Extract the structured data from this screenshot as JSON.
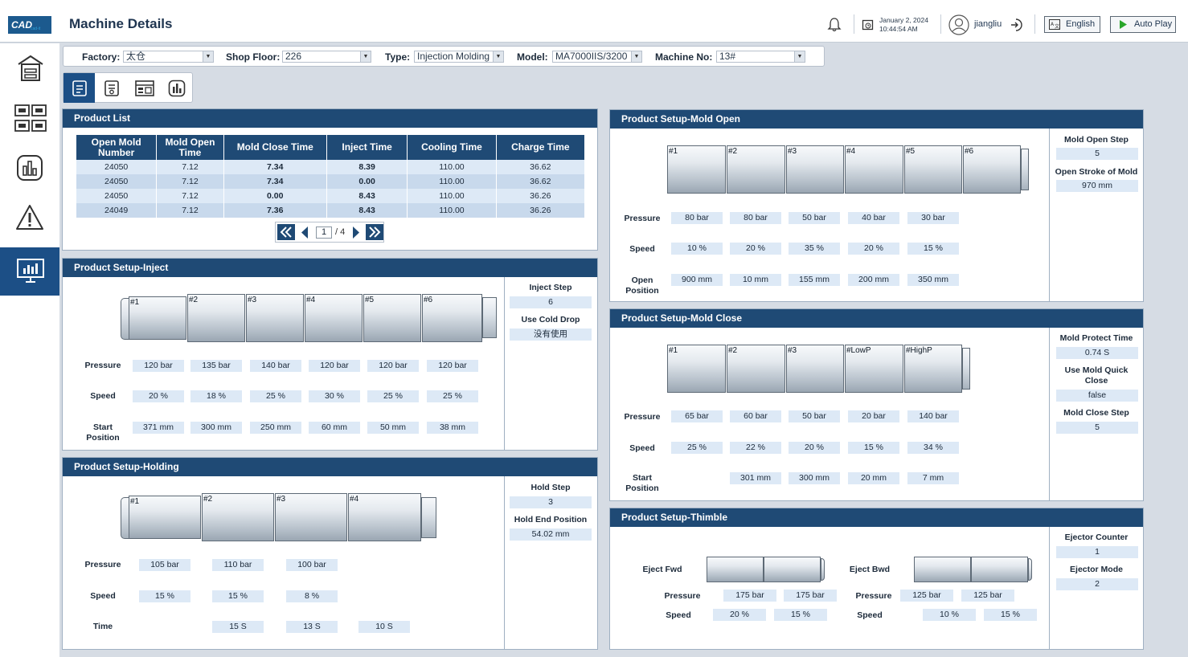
{
  "header": {
    "logo_text": "CAD",
    "logo_sub": "cad-it",
    "title": "Machine Details",
    "date": "January 2, 2024",
    "time": "10:44:54 AM",
    "user": "jiangliu",
    "language_label": "English",
    "autoplay_label": "Auto Play",
    "icons": [
      "bell-icon",
      "calendar-clock-icon",
      "user-avatar-icon",
      "logout-icon",
      "language-icon",
      "play-icon"
    ]
  },
  "sidebar": {
    "items": [
      {
        "name": "factory",
        "icon": "factory-icon",
        "active": false
      },
      {
        "name": "machines",
        "icon": "machines-grid-icon",
        "active": false
      },
      {
        "name": "reports",
        "icon": "report-chart-icon",
        "active": false
      },
      {
        "name": "alarms",
        "icon": "warning-icon",
        "active": false
      },
      {
        "name": "monitor",
        "icon": "monitor-icon",
        "active": true
      }
    ]
  },
  "filters": {
    "factory_label": "Factory:",
    "factory_value": "太仓",
    "floor_label": "Shop Floor:",
    "floor_value": "226",
    "type_label": "Type:",
    "type_value": "Injection Molding M",
    "model_label": "Model:",
    "model_value": "MA7000IIS/3200",
    "machine_label": "Machine No:",
    "machine_value": "13#"
  },
  "view_tabs": [
    {
      "icon": "product-doc-icon",
      "active": true
    },
    {
      "icon": "settings-doc-icon",
      "active": false
    },
    {
      "icon": "machine-panel-icon",
      "active": false
    },
    {
      "icon": "bar-chart-icon",
      "active": false
    }
  ],
  "product_list": {
    "title": "Product List",
    "columns": [
      "Open Mold Number",
      "Mold Open Time",
      "Mold Close Time",
      "Inject Time",
      "Cooling Time",
      "Charge Time"
    ],
    "rows": [
      [
        "24050",
        "7.12",
        "7.34",
        "8.39",
        "110.00",
        "36.62"
      ],
      [
        "24050",
        "7.12",
        "7.34",
        "0.00",
        "110.00",
        "36.62"
      ],
      [
        "24050",
        "7.12",
        "0.00",
        "8.43",
        "110.00",
        "36.26"
      ],
      [
        "24049",
        "7.12",
        "7.36",
        "8.43",
        "110.00",
        "36.26"
      ]
    ],
    "page_current": "1",
    "page_total": "/ 4"
  },
  "inject": {
    "title": "Product Setup-Inject",
    "stages": [
      "#1",
      "#2",
      "#3",
      "#4",
      "#5",
      "#6"
    ],
    "pressure_label": "Pressure",
    "pressure": [
      "120 bar",
      "135 bar",
      "140 bar",
      "120 bar",
      "120 bar",
      "120 bar"
    ],
    "speed_label": "Speed",
    "speed": [
      "20 %",
      "18 %",
      "25 %",
      "30 %",
      "25 %",
      "25 %"
    ],
    "position_label": "Start Position",
    "position": [
      "371 mm",
      "300 mm",
      "250 mm",
      "60 mm",
      "50 mm",
      "38 mm"
    ],
    "step_label": "Inject Step",
    "step_value": "6",
    "cold_drop_label": "Use Cold Drop",
    "cold_drop_value": "没有使用"
  },
  "holding": {
    "title": "Product Setup-Holding",
    "stages": [
      "#1",
      "#2",
      "#3",
      "#4"
    ],
    "pressure_label": "Pressure",
    "pressure": [
      "105 bar",
      "110 bar",
      "100 bar"
    ],
    "speed_label": "Speed",
    "speed": [
      "15 %",
      "15 %",
      "8 %"
    ],
    "time_label": "Time",
    "time": [
      "15 S",
      "13 S",
      "10 S"
    ],
    "step_label": "Hold Step",
    "step_value": "3",
    "end_label": "Hold End Position",
    "end_value": "54.02 mm"
  },
  "mold_open": {
    "title": "Product Setup-Mold Open",
    "stages": [
      "#1",
      "#2",
      "#3",
      "#4",
      "#5",
      "#6"
    ],
    "pressure_label": "Pressure",
    "pressure": [
      "80 bar",
      "80 bar",
      "50 bar",
      "40 bar",
      "30 bar"
    ],
    "speed_label": "Speed",
    "speed": [
      "10 %",
      "20 %",
      "35 %",
      "20 %",
      "15 %"
    ],
    "position_label": "Open Position",
    "position": [
      "900 mm",
      "10 mm",
      "155 mm",
      "200 mm",
      "350 mm"
    ],
    "step_label": "Mold Open Step",
    "step_value": "5",
    "stroke_label": "Open Stroke of Mold",
    "stroke_value": "970 mm"
  },
  "mold_close": {
    "title": "Product Setup-Mold Close",
    "stages": [
      "#1",
      "#2",
      "#3",
      "#LowP",
      "#HighP"
    ],
    "pressure_label": "Pressure",
    "pressure": [
      "65 bar",
      "60 bar",
      "50 bar",
      "20 bar",
      "140 bar"
    ],
    "speed_label": "Speed",
    "speed": [
      "25 %",
      "22 %",
      "20 %",
      "15 %",
      "34 %"
    ],
    "position_label": "Start Position",
    "position": [
      "301 mm",
      "300 mm",
      "20 mm",
      "7 mm"
    ],
    "protect_label": "Mold Protect Time",
    "protect_value": "0.74 S",
    "quick_label": "Use Mold Quick Close",
    "quick_value": "false",
    "step_label": "Mold Close Step",
    "step_value": "5"
  },
  "thimble": {
    "title": "Product Setup-Thimble",
    "fwd_label": "Eject Fwd",
    "bwd_label": "Eject Bwd",
    "pressure_label": "Pressure",
    "speed_label": "Speed",
    "fwd_pressure": [
      "175 bar",
      "175 bar"
    ],
    "fwd_speed": [
      "20 %",
      "15 %"
    ],
    "bwd_pressure": [
      "125 bar",
      "125 bar"
    ],
    "bwd_speed": [
      "10 %",
      "15 %"
    ],
    "counter_label": "Ejector Counter",
    "counter_value": "1",
    "mode_label": "Ejector Mode",
    "mode_value": "2"
  }
}
